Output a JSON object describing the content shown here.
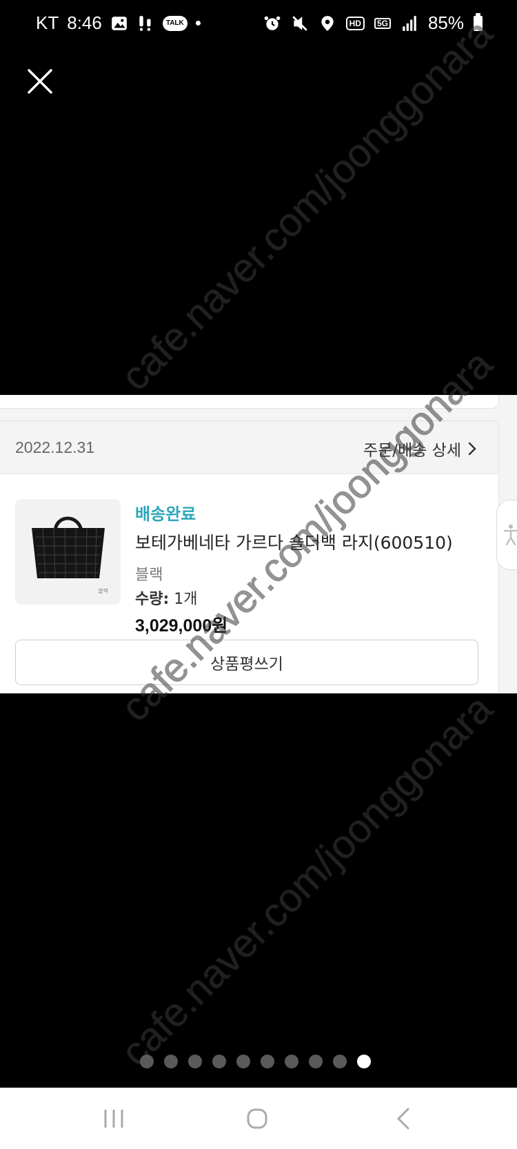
{
  "status_bar": {
    "carrier": "KT",
    "time": "8:46",
    "talk_badge": "TALK",
    "network_hd": "HD",
    "network_5g": "5G",
    "battery": "85%",
    "icons": [
      "image-icon",
      "notification-icon",
      "talk-icon",
      "alarm-icon",
      "vibrate-icon",
      "location-icon",
      "hd-icon",
      "5g-icon",
      "signal-icon",
      "battery-icon"
    ]
  },
  "viewer": {
    "close_icon": "close-icon",
    "watermark": "cafe.naver.com/joonggonara",
    "pager": {
      "total": 10,
      "active_index": 9
    }
  },
  "order": {
    "date": "2022.12.31",
    "detail_link": "주문/배송 상세",
    "status": "배송완료",
    "product_name": "보테가베네타 가르다 숄더백 라지(600510)",
    "thumbnail_caption": "블랙",
    "option": "블랙",
    "quantity_label": "수량:",
    "quantity_value": "1개",
    "price": "3,029,000원",
    "review_button": "상품평쓰기"
  },
  "colors": {
    "accent_teal": "#2ba7b8",
    "background": "#000000",
    "panel": "#f4f4f5"
  }
}
